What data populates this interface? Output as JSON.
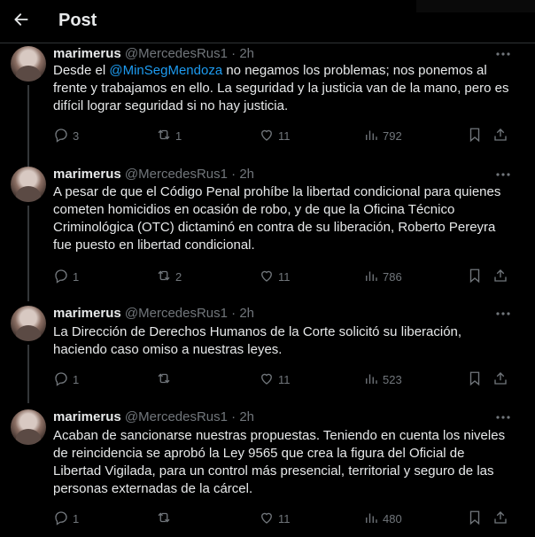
{
  "header": {
    "title": "Post"
  },
  "tweets": [
    {
      "user_name": "marimerus",
      "handle": "@MercedesRus1",
      "dot": "·",
      "time": "2h",
      "text_before": "Desde el ",
      "mention": "@MinSegMendoza",
      "text_after": " no negamos los problemas; nos ponemos al frente y trabajamos en ello. La seguridad y la justicia van de la mano, pero es difícil lograr seguridad si no hay justicia.",
      "replies": "3",
      "reposts": "1",
      "likes": "11",
      "views": "792"
    },
    {
      "user_name": "marimerus",
      "handle": "@MercedesRus1",
      "dot": "·",
      "time": "2h",
      "text": "A pesar de que el Código Penal prohíbe la libertad condicional para quienes cometen homicidios en ocasión de robo, y de que la Oficina Técnico Criminológica (OTC) dictaminó en contra de su liberación, Roberto Pereyra fue puesto en libertad condicional.",
      "replies": "1",
      "reposts": "2",
      "likes": "11",
      "views": "786"
    },
    {
      "user_name": "marimerus",
      "handle": "@MercedesRus1",
      "dot": "·",
      "time": "2h",
      "text": "La Dirección de Derechos Humanos de la Corte solicitó su liberación, haciendo caso omiso a nuestras leyes.",
      "replies": "1",
      "reposts": "",
      "likes": "11",
      "views": "523"
    },
    {
      "user_name": "marimerus",
      "handle": "@MercedesRus1",
      "dot": "·",
      "time": "2h",
      "text": "Acaban de sancionarse nuestras propuestas. Teniendo en cuenta los niveles de reincidencia se aprobó la Ley 9565 que crea la figura del Oficial de Libertad Vigilada, para un control más presencial, territorial y seguro de las personas externadas de la cárcel.",
      "replies": "1",
      "reposts": "",
      "likes": "11",
      "views": "480"
    }
  ],
  "icons": {
    "back": "arrow-left-icon",
    "more": "more-icon",
    "reply": "reply-icon",
    "repost": "repost-icon",
    "like": "heart-icon",
    "views": "views-icon",
    "bookmark": "bookmark-icon",
    "share": "share-icon"
  },
  "colors": {
    "background": "#000000",
    "text": "#e7e9ea",
    "secondary": "#71767b",
    "link": "#1d9bf0",
    "border": "#2f3336"
  }
}
